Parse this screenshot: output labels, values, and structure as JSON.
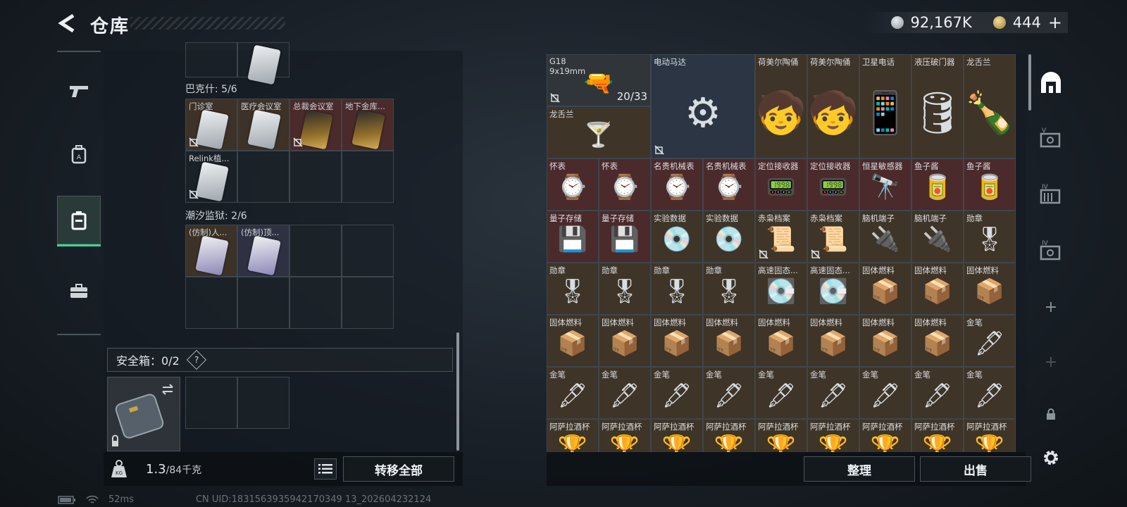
{
  "header": {
    "title": "仓库",
    "silver": "92,167K",
    "gold": "444",
    "plus": "+"
  },
  "left": {
    "bakesh_label": "巴克什: 5/6",
    "bakesh_items": [
      {
        "label": "门诊室",
        "tone": "brown",
        "card": "silver",
        "noxfer": true
      },
      {
        "label": "医疗会议室",
        "tone": "brown",
        "card": "silver",
        "noxfer": false
      },
      {
        "label": "总裁会议室",
        "tone": "red",
        "card": "gold",
        "noxfer": true
      },
      {
        "label": "地下金库...",
        "tone": "red",
        "card": "gold",
        "noxfer": false
      },
      {
        "label": "Relink植...",
        "tone": "",
        "card": "silver",
        "noxfer": true
      }
    ],
    "tide_label": "潮汐监狱: 2/6",
    "tide_items": [
      {
        "label": "(仿制)人...",
        "tone": "brown",
        "card": "purple"
      },
      {
        "label": "(仿制)顶...",
        "tone": "blue",
        "card": "purple"
      }
    ],
    "safe_label": "安全箱：0/2",
    "safe_q": "?",
    "weight_current": "1.3",
    "weight_max": "/84千克",
    "transfer_label": "转移全部"
  },
  "right": {
    "items": [
      {
        "name": "G18",
        "sub": "9x19mm",
        "tone": "dark",
        "glyph": "🔫",
        "count": "20/33",
        "noxfer": true
      },
      {
        "name": "电动马达",
        "tone": "blue",
        "glyph": "⚙",
        "noxfer": true
      },
      {
        "name": "荷美尔陶俑",
        "tone": "brown",
        "glyph": "🧒"
      },
      {
        "name": "荷美尔陶俑",
        "tone": "brown",
        "glyph": "🧒"
      },
      {
        "name": "卫星电话",
        "tone": "brown",
        "glyph": "📱"
      },
      {
        "name": "液压破门器",
        "tone": "brown",
        "glyph": "🛢"
      },
      {
        "name": "龙舌兰",
        "tone": "brown",
        "glyph": "🍾"
      },
      {
        "name": "龙舌兰",
        "tone": "brown",
        "glyph": "🍸"
      },
      {
        "name": "怀表",
        "tone": "red",
        "glyph": "⌚"
      },
      {
        "name": "怀表",
        "tone": "red",
        "glyph": "⌚"
      },
      {
        "name": "名贵机械表",
        "tone": "red",
        "glyph": "⌚"
      },
      {
        "name": "名贵机械表",
        "tone": "red",
        "glyph": "⌚"
      },
      {
        "name": "定位接收器",
        "tone": "red",
        "glyph": "📟"
      },
      {
        "name": "定位接收器",
        "tone": "red",
        "glyph": "📟"
      },
      {
        "name": "恒星敏感器",
        "tone": "red",
        "glyph": "🔭"
      },
      {
        "name": "鱼子酱",
        "tone": "red",
        "glyph": "🥫"
      },
      {
        "name": "鱼子酱",
        "tone": "red",
        "glyph": "🥫"
      },
      {
        "name": "量子存储",
        "tone": "red",
        "glyph": "💾"
      },
      {
        "name": "量子存储",
        "tone": "red",
        "glyph": "💾"
      },
      {
        "name": "实验数据",
        "tone": "brown",
        "glyph": "💿"
      },
      {
        "name": "实验数据",
        "tone": "brown",
        "glyph": "💿"
      },
      {
        "name": "赤枭档案",
        "tone": "brown",
        "glyph": "📜",
        "noxfer": true
      },
      {
        "name": "赤枭档案",
        "tone": "brown",
        "glyph": "📜",
        "noxfer": true
      },
      {
        "name": "脑机端子",
        "tone": "brown",
        "glyph": "🔌"
      },
      {
        "name": "脑机端子",
        "tone": "brown",
        "glyph": "🔌"
      },
      {
        "name": "勋章",
        "tone": "brown",
        "glyph": "🎖"
      },
      {
        "name": "勋章",
        "tone": "brown",
        "glyph": "🎖"
      },
      {
        "name": "勋章",
        "tone": "brown",
        "glyph": "🎖"
      },
      {
        "name": "勋章",
        "tone": "brown",
        "glyph": "🎖"
      },
      {
        "name": "勋章",
        "tone": "brown",
        "glyph": "🎖"
      },
      {
        "name": "高速固态...",
        "tone": "brown",
        "glyph": "💽"
      },
      {
        "name": "高速固态...",
        "tone": "brown",
        "glyph": "💽"
      },
      {
        "name": "固体燃料",
        "tone": "brown",
        "glyph": "📦"
      },
      {
        "name": "固体燃料",
        "tone": "brown",
        "glyph": "📦"
      },
      {
        "name": "固体燃料",
        "tone": "brown",
        "glyph": "📦"
      },
      {
        "name": "固体燃料",
        "tone": "brown",
        "glyph": "📦"
      },
      {
        "name": "固体燃料",
        "tone": "brown",
        "glyph": "📦"
      },
      {
        "name": "固体燃料",
        "tone": "brown",
        "glyph": "📦"
      },
      {
        "name": "固体燃料",
        "tone": "brown",
        "glyph": "📦"
      },
      {
        "name": "固体燃料",
        "tone": "brown",
        "glyph": "📦"
      },
      {
        "name": "固体燃料",
        "tone": "brown",
        "glyph": "📦"
      },
      {
        "name": "固体燃料",
        "tone": "brown",
        "glyph": "📦"
      },
      {
        "name": "固体燃料",
        "tone": "brown",
        "glyph": "📦"
      },
      {
        "name": "金笔",
        "tone": "brown",
        "glyph": "🖋"
      },
      {
        "name": "金笔",
        "tone": "brown",
        "glyph": "🖋"
      },
      {
        "name": "金笔",
        "tone": "brown",
        "glyph": "🖋"
      },
      {
        "name": "金笔",
        "tone": "brown",
        "glyph": "🖋"
      },
      {
        "name": "金笔",
        "tone": "brown",
        "glyph": "🖋"
      },
      {
        "name": "金笔",
        "tone": "brown",
        "glyph": "🖋"
      },
      {
        "name": "金笔",
        "tone": "brown",
        "glyph": "🖋"
      },
      {
        "name": "金笔",
        "tone": "brown",
        "glyph": "🖋"
      },
      {
        "name": "金笔",
        "tone": "brown",
        "glyph": "🖋"
      },
      {
        "name": "金笔",
        "tone": "brown",
        "glyph": "🖋"
      },
      {
        "name": "阿萨拉酒杯",
        "tone": "brown",
        "glyph": "🏆"
      },
      {
        "name": "阿萨拉酒杯",
        "tone": "brown",
        "glyph": "🏆"
      },
      {
        "name": "阿萨拉酒杯",
        "tone": "brown",
        "glyph": "🏆"
      },
      {
        "name": "阿萨拉酒杯",
        "tone": "brown",
        "glyph": "🏆"
      },
      {
        "name": "阿萨拉酒杯",
        "tone": "brown",
        "glyph": "🏆"
      },
      {
        "name": "阿萨拉酒杯",
        "tone": "brown",
        "glyph": "🏆"
      },
      {
        "name": "阿萨拉酒杯",
        "tone": "brown",
        "glyph": "🏆"
      },
      {
        "name": "阿萨拉酒杯",
        "tone": "brown",
        "glyph": "🏆"
      },
      {
        "name": "阿萨拉酒杯",
        "tone": "brown",
        "glyph": "🏆"
      }
    ],
    "sort_label": "整理",
    "sell_label": "出售",
    "nav_labels": [
      "V",
      "IV",
      "IV"
    ]
  },
  "status": {
    "ping": "52ms",
    "uid": "CN UID:1831563935942170349 13_202604232124"
  }
}
